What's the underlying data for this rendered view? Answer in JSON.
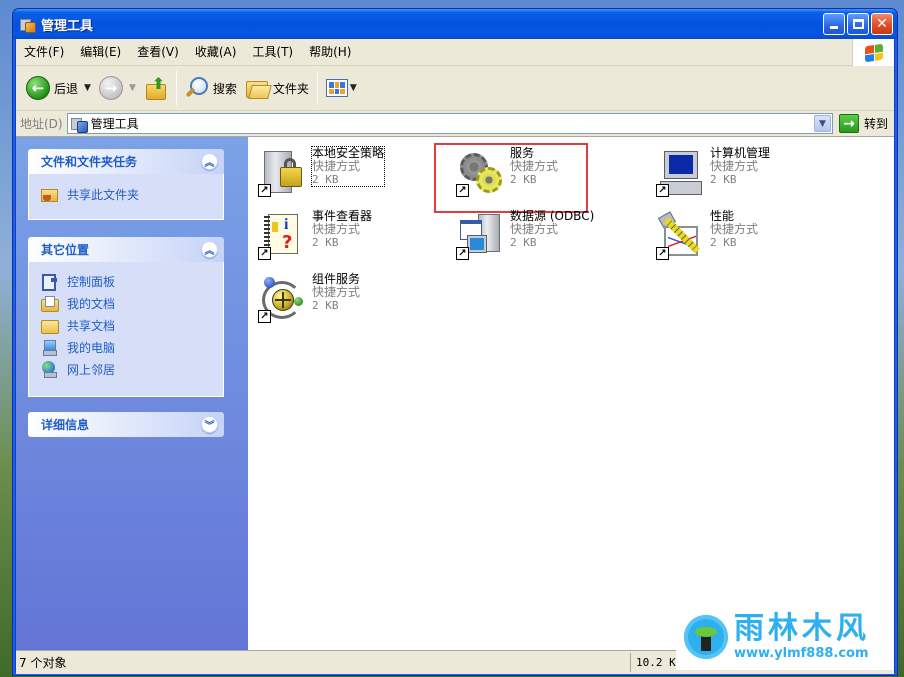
{
  "window": {
    "title": "管理工具",
    "controls": {
      "minimize": "minimize",
      "maximize": "maximize",
      "close": "close"
    }
  },
  "menu": [
    "文件(F)",
    "编辑(E)",
    "查看(V)",
    "收藏(A)",
    "工具(T)",
    "帮助(H)"
  ],
  "toolbar": {
    "back_label": "后退",
    "forward_label": "",
    "up_label": "",
    "search_label": "搜索",
    "folders_label": "文件夹",
    "views_label": ""
  },
  "address": {
    "label": "地址(D)",
    "value": "管理工具",
    "go_label": "转到"
  },
  "taskpane": {
    "panels": [
      {
        "title": "文件和文件夹任务",
        "expanded": true,
        "items": [
          {
            "label": "共享此文件夹",
            "icon": "share-folder-icon"
          }
        ]
      },
      {
        "title": "其它位置",
        "expanded": true,
        "items": [
          {
            "label": "控制面板",
            "icon": "control-panel-icon"
          },
          {
            "label": "我的文档",
            "icon": "my-documents-icon"
          },
          {
            "label": "共享文档",
            "icon": "shared-documents-icon"
          },
          {
            "label": "我的电脑",
            "icon": "my-computer-icon"
          },
          {
            "label": "网上邻居",
            "icon": "network-places-icon"
          }
        ]
      },
      {
        "title": "详细信息",
        "expanded": false,
        "items": []
      }
    ]
  },
  "files": [
    {
      "name": "本地安全策略",
      "type": "快捷方式",
      "size": "2 KB",
      "icon": "local-security-policy-icon",
      "focused": true
    },
    {
      "name": "服务",
      "type": "快捷方式",
      "size": "2 KB",
      "icon": "services-icon",
      "highlighted": true
    },
    {
      "name": "计算机管理",
      "type": "快捷方式",
      "size": "2 KB",
      "icon": "computer-management-icon"
    },
    {
      "name": "事件查看器",
      "type": "快捷方式",
      "size": "2 KB",
      "icon": "event-viewer-icon"
    },
    {
      "name": "数据源 (ODBC)",
      "type": "快捷方式",
      "size": "2 KB",
      "icon": "odbc-data-source-icon"
    },
    {
      "name": "性能",
      "type": "快捷方式",
      "size": "2 KB",
      "icon": "performance-icon"
    },
    {
      "name": "组件服务",
      "type": "快捷方式",
      "size": "2 KB",
      "icon": "component-services-icon"
    }
  ],
  "status": {
    "objects": "7 个对象",
    "size": "10.2 KB"
  },
  "watermark": {
    "brand": "雨林木风",
    "url": "www.ylmf888.com"
  },
  "colors": {
    "titlebar": "#0453dc",
    "taskpane_link": "#215dc6",
    "highlight_box": "#e23c3c",
    "watermark": "#2eb0ee"
  }
}
